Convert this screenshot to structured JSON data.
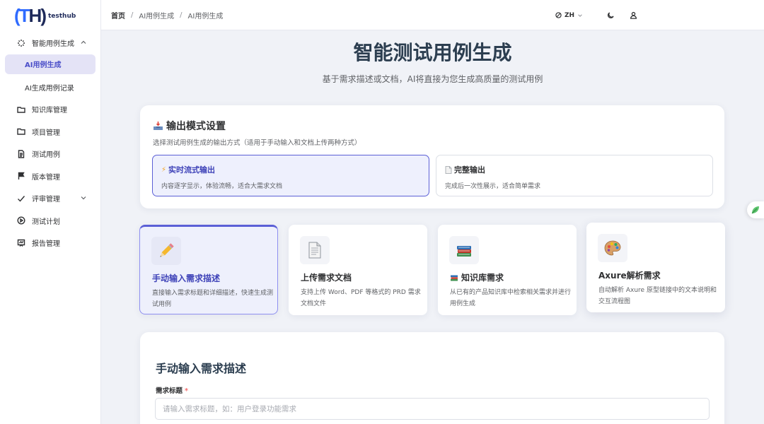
{
  "app": {
    "logo_mark_left": "(T",
    "logo_mark_right": "H)",
    "logo_text": "testhub"
  },
  "sidebar": {
    "items": [
      {
        "label": "智能用例生成",
        "icon": "sparkle-icon",
        "expanded": true
      },
      {
        "label": "AI用例生成",
        "active": true
      },
      {
        "label": "AI生成用例记录"
      },
      {
        "label": "知识库管理",
        "icon": "folder-icon"
      },
      {
        "label": "项目管理",
        "icon": "folder-icon"
      },
      {
        "label": "测试用例",
        "icon": "document-icon"
      },
      {
        "label": "版本管理",
        "icon": "flag-icon"
      },
      {
        "label": "评审管理",
        "icon": "check-icon",
        "expanded": false
      },
      {
        "label": "测试计划",
        "icon": "play-circle-icon"
      },
      {
        "label": "报告管理",
        "icon": "report-icon"
      }
    ]
  },
  "header": {
    "breadcrumb": [
      "首页",
      "AI用例生成",
      "AI用例生成"
    ],
    "separator": "/",
    "language": "ZH",
    "icons": [
      "globe-icon",
      "moon-icon",
      "user-icon"
    ]
  },
  "main": {
    "title": "智能测试用例生成",
    "subtitle": "基于需求描述或文档，AI将直接为您生成高质量的测试用例",
    "output_mode": {
      "title": "输出模式设置",
      "description": "选择测试用例生成的输出方式（适用于手动输入和文档上传两种方式）",
      "options": [
        {
          "icon": "⚡",
          "title": "实时流式输出",
          "description": "内容逐字显示，体验流畅，适合大需求文档",
          "selected": true
        },
        {
          "title": "完整输出",
          "description": "完成后一次性展示，适合简单需求",
          "selected": false
        }
      ]
    },
    "sources": [
      {
        "title": "手动输入需求描述",
        "description": "直接输入需求标题和详细描述，快速生成测试用例",
        "icon": "pencil-icon",
        "selected": true
      },
      {
        "title": "上传需求文档",
        "description": "支持上传 Word、PDF 等格式的 PRD 需求文档文件",
        "icon": "document-icon"
      },
      {
        "title": "知识库需求",
        "description": "从已有的产品知识库中检索相关需求并进行用例生成",
        "icon": "books-icon"
      },
      {
        "title": "Axure解析需求",
        "description": "自动解析 Axure 原型链接中的文本说明和交互流程图",
        "icon": "palette-icon"
      }
    ],
    "form": {
      "title": "手动输入需求描述",
      "label": "需求标题",
      "required_mark": "*",
      "placeholder": "请输入需求标题，如：用户登录功能需求",
      "value": ""
    }
  },
  "colors": {
    "accent": "#5b5fd6",
    "title": "#2c3e50",
    "brand": "#2f6bff"
  }
}
